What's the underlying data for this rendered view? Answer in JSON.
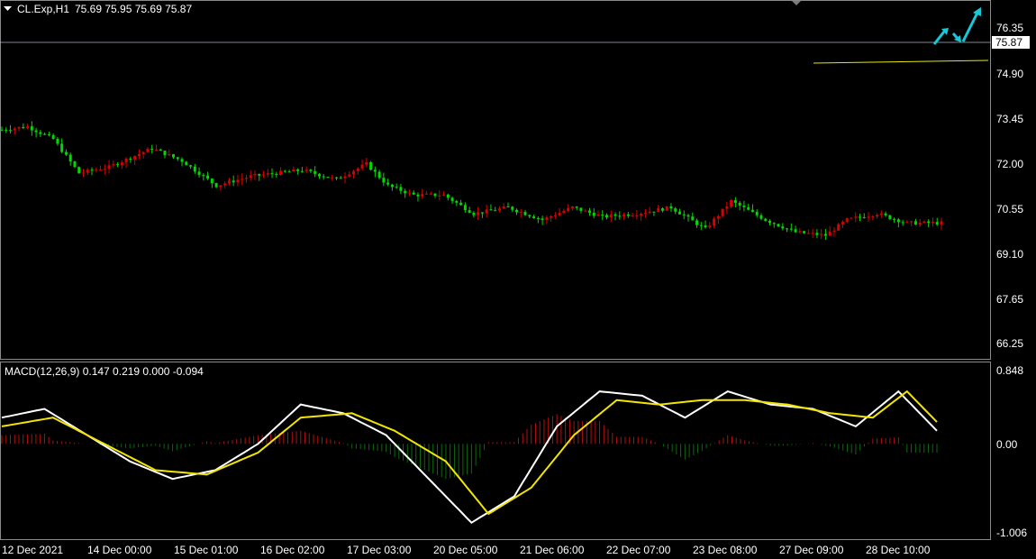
{
  "header": {
    "menu_icon": "triangle-down-icon",
    "symbol": "CL.Exp,H1",
    "ohlc": "75.69 75.95 75.69 75.87"
  },
  "price_axis": {
    "labels": [
      "76.35",
      "74.90",
      "73.45",
      "72.00",
      "70.55",
      "69.10",
      "67.65",
      "66.25"
    ],
    "current_price": "75.87"
  },
  "macd": {
    "title": "MACD(12,26,9) 0.147 0.219 0.000 -0.094",
    "axis_labels": [
      "0.848",
      "0.00",
      "-1.006"
    ]
  },
  "time_axis": {
    "labels": [
      "12 Dec 2021",
      "14 Dec 00:00",
      "15 Dec 01:00",
      "16 Dec 02:00",
      "17 Dec 03:00",
      "20 Dec 05:00",
      "21 Dec 06:00",
      "22 Dec 07:00",
      "23 Dec 08:00",
      "27 Dec 09:00",
      "28 Dec 10:00"
    ]
  },
  "colors": {
    "background": "#000000",
    "bull": "#00d800",
    "bear": "#d80000",
    "macd_line": "#ffffff",
    "signal_line": "#f2e500",
    "hist_pos": "#b01010",
    "hist_neg": "#0c6a0c",
    "arrows": "#17c8d8",
    "support_line": "#e8e800",
    "axis": "#8a8a8a"
  },
  "chart_data": {
    "type": "candlestick",
    "ylim": [
      65.8,
      77.0
    ],
    "x_range": [
      0,
      219
    ],
    "series": [
      {
        "name": "price_path",
        "values": [
          [
            0,
            73.0
          ],
          [
            6,
            73.1
          ],
          [
            12,
            72.7
          ],
          [
            18,
            71.6
          ],
          [
            25,
            71.8
          ],
          [
            35,
            72.4
          ],
          [
            42,
            72.0
          ],
          [
            50,
            71.2
          ],
          [
            58,
            71.5
          ],
          [
            70,
            71.7
          ],
          [
            78,
            71.4
          ],
          [
            85,
            71.9
          ],
          [
            90,
            71.2
          ],
          [
            96,
            70.9
          ],
          [
            103,
            70.9
          ],
          [
            110,
            70.3
          ],
          [
            118,
            70.5
          ],
          [
            126,
            70.1
          ],
          [
            133,
            70.5
          ],
          [
            140,
            70.2
          ],
          [
            148,
            70.3
          ],
          [
            156,
            70.5
          ],
          [
            164,
            69.8
          ],
          [
            170,
            70.7
          ],
          [
            178,
            70.1
          ],
          [
            185,
            69.7
          ],
          [
            192,
            69.6
          ],
          [
            197,
            70.1
          ],
          [
            204,
            70.3
          ],
          [
            211,
            70.0
          ],
          [
            219,
            70.0
          ]
        ]
      }
    ],
    "marked_levels": {
      "current": 75.87,
      "support": 75.3
    },
    "macd": {
      "ylim": [
        -1.006,
        0.848
      ],
      "line_path": [
        [
          0,
          0.3
        ],
        [
          10,
          0.4
        ],
        [
          20,
          0.1
        ],
        [
          30,
          -0.2
        ],
        [
          40,
          -0.4
        ],
        [
          50,
          -0.3
        ],
        [
          60,
          0.0
        ],
        [
          70,
          0.45
        ],
        [
          80,
          0.35
        ],
        [
          90,
          0.1
        ],
        [
          100,
          -0.4
        ],
        [
          110,
          -0.9
        ],
        [
          120,
          -0.6
        ],
        [
          130,
          0.2
        ],
        [
          140,
          0.6
        ],
        [
          150,
          0.55
        ],
        [
          160,
          0.3
        ],
        [
          170,
          0.6
        ],
        [
          180,
          0.45
        ],
        [
          190,
          0.4
        ],
        [
          200,
          0.2
        ],
        [
          210,
          0.6
        ],
        [
          219,
          0.15
        ]
      ],
      "signal_path": [
        [
          0,
          0.2
        ],
        [
          12,
          0.3
        ],
        [
          24,
          0.0
        ],
        [
          36,
          -0.3
        ],
        [
          48,
          -0.35
        ],
        [
          60,
          -0.1
        ],
        [
          70,
          0.3
        ],
        [
          82,
          0.35
        ],
        [
          92,
          0.15
        ],
        [
          104,
          -0.2
        ],
        [
          114,
          -0.8
        ],
        [
          124,
          -0.5
        ],
        [
          134,
          0.1
        ],
        [
          144,
          0.5
        ],
        [
          154,
          0.45
        ],
        [
          164,
          0.5
        ],
        [
          174,
          0.5
        ],
        [
          184,
          0.45
        ],
        [
          194,
          0.35
        ],
        [
          204,
          0.3
        ],
        [
          212,
          0.6
        ],
        [
          219,
          0.25
        ]
      ]
    }
  }
}
